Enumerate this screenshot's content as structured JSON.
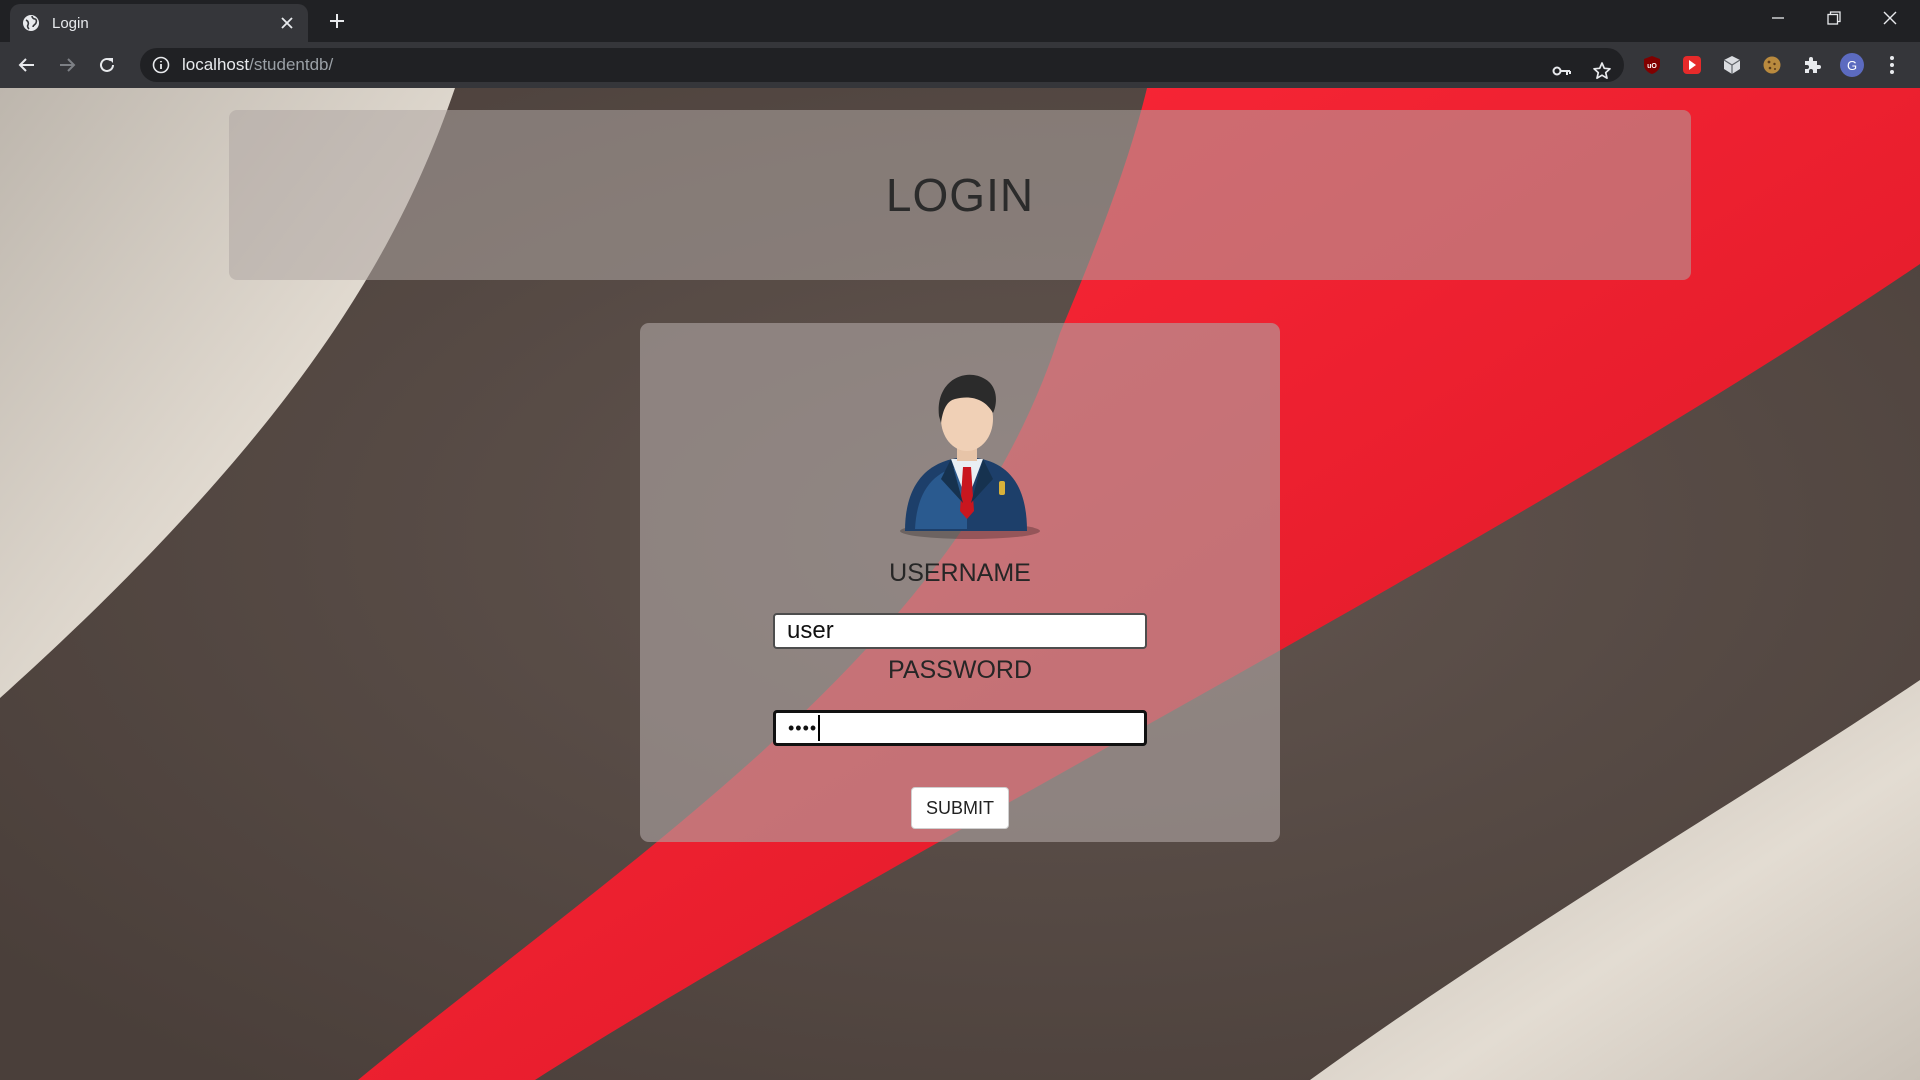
{
  "browser": {
    "tab_title": "Login",
    "url_host": "localhost",
    "url_path": "/studentdb/",
    "profile_initial": "G"
  },
  "page": {
    "header_title": "LOGIN",
    "username_label": "USERNAME",
    "username_value": "user",
    "password_label": "PASSWORD",
    "password_masked": "••••",
    "submit_label": "SUBMIT"
  },
  "colors": {
    "chrome_dark": "#202124",
    "chrome_toolbar": "#35363a",
    "accent_red": "#e8182a",
    "bg_brown": "#5a4d47",
    "bg_cream": "#e2dbd2"
  },
  "icons": {
    "tab_favicon": "globe-icon",
    "tab_close": "close-icon",
    "new_tab": "plus-icon",
    "back": "arrow-left-icon",
    "forward": "arrow-right-icon",
    "reload": "reload-icon",
    "site_info": "info-icon",
    "password_key": "key-icon",
    "bookmark": "star-icon",
    "extensions": "puzzle-icon",
    "menu": "kebab-menu-icon",
    "user_avatar": "businessman-avatar-icon"
  }
}
